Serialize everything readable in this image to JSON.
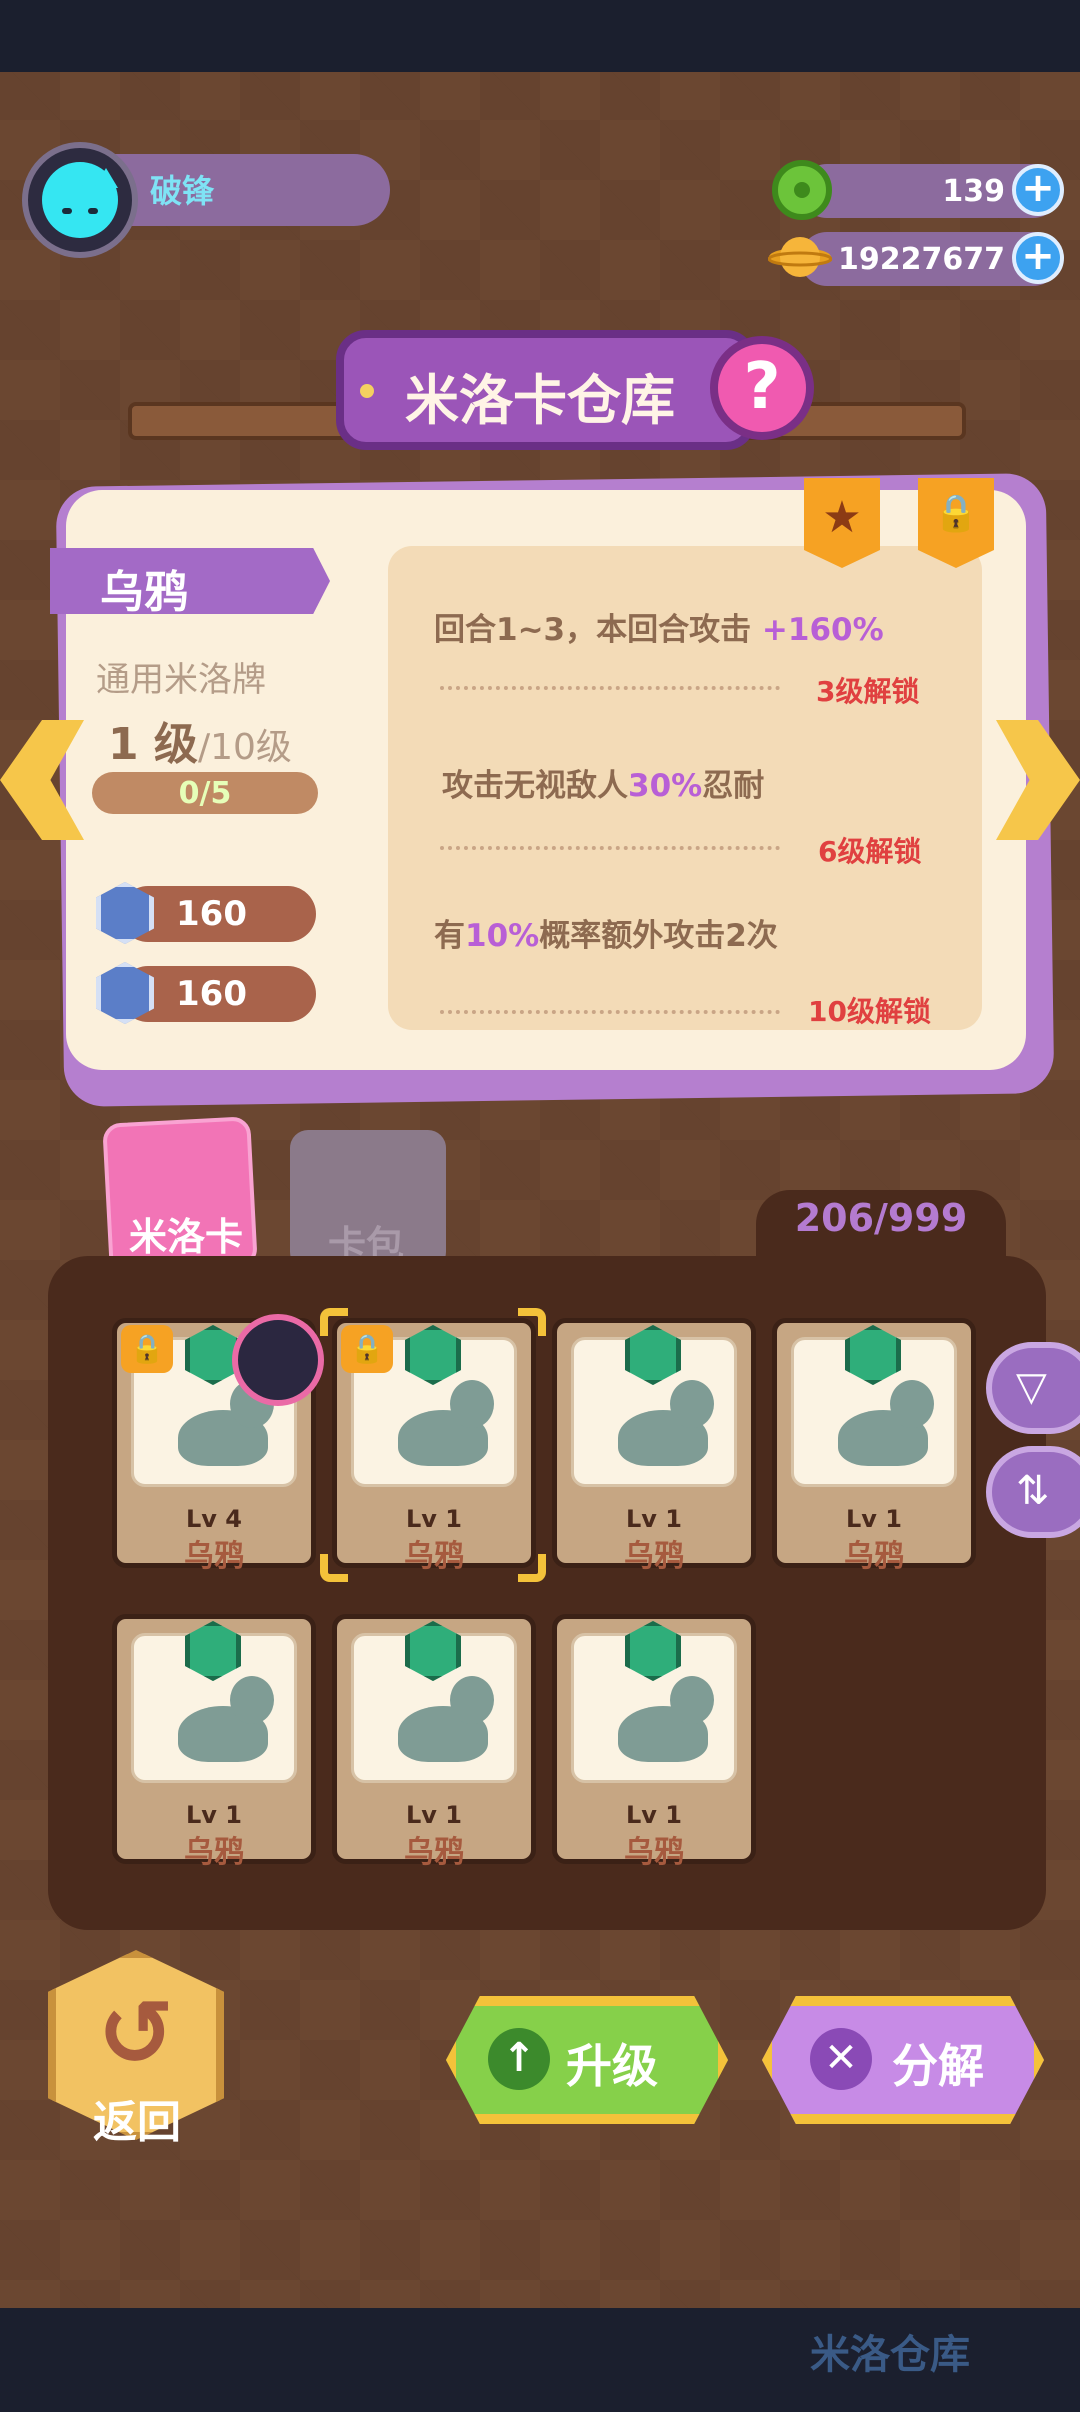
{
  "player": {
    "name": "破锋"
  },
  "currencies": [
    {
      "name": "donut",
      "value": "139"
    },
    {
      "name": "coin-planet",
      "value": "19227677"
    }
  ],
  "title": "米洛卡仓库",
  "card": {
    "name": "乌鸦",
    "type": "通用米洛牌",
    "level": "1 级",
    "max_level": "/10级",
    "xp": "0/5",
    "stats": [
      "160",
      "160"
    ]
  },
  "skills": [
    {
      "pre": "回合1~3，本回合攻击 ",
      "hl": "+160%",
      "post": "",
      "unlock": "3级解锁"
    },
    {
      "pre": "攻击无视敌人",
      "hl": "30%",
      "post": "忍耐",
      "unlock": "6级解锁"
    },
    {
      "pre": "有",
      "hl": "10%",
      "post": "概率额外攻击2次",
      "unlock": "10级解锁"
    }
  ],
  "tabs": {
    "milo": "米洛卡",
    "pack": "卡包"
  },
  "inventory_count": "206/999",
  "cards": [
    {
      "lv": "Lv 4",
      "name": "乌鸦"
    },
    {
      "lv": "Lv 1",
      "name": "乌鸦"
    },
    {
      "lv": "Lv 1",
      "name": "乌鸦"
    },
    {
      "lv": "Lv 1",
      "name": "乌鸦"
    },
    {
      "lv": "Lv 1",
      "name": "乌鸦"
    },
    {
      "lv": "Lv 1",
      "name": "乌鸦"
    },
    {
      "lv": "Lv 1",
      "name": "乌鸦"
    }
  ],
  "actions": {
    "back": "返回",
    "upgrade": "升级",
    "decompose": "分解"
  },
  "dock": {
    "label": "米洛仓库"
  },
  "icons": {
    "plus": "+",
    "back": "↺",
    "up": "↑",
    "close": "✕",
    "filter": "▽",
    "sort": "⇅",
    "star": "★",
    "lock": "🔒",
    "question": "?"
  }
}
